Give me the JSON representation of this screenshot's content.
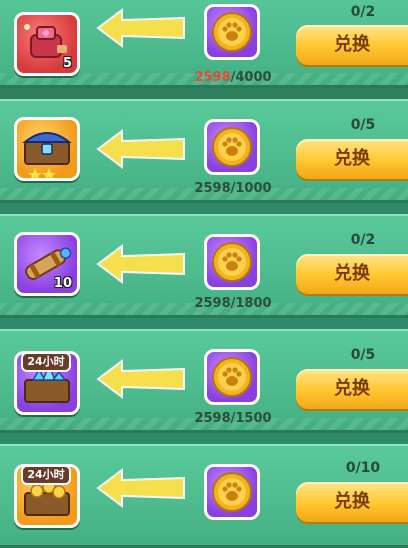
{
  "currency_icon": "paw-coin-icon",
  "colors": {
    "row_bg": "#4dbb8d",
    "button": "#ffc62e",
    "button_text": "#7a3b0a",
    "insufficient": "#e24a3a"
  },
  "items": [
    {
      "reward_icon": "red-gem-box-icon",
      "reward_qty": "5",
      "tag": "",
      "cost_have": "2598",
      "cost_need": "4000",
      "insufficient": true,
      "limit": "0/2",
      "button": "兑换"
    },
    {
      "reward_icon": "treasure-chest-icon",
      "reward_qty": "",
      "tag": "",
      "cost_have": "2598",
      "cost_need": "1000",
      "insufficient": false,
      "limit": "0/5",
      "button": "兑换"
    },
    {
      "reward_icon": "scroll-cannon-icon",
      "reward_qty": "10",
      "tag": "",
      "cost_have": "2598",
      "cost_need": "1800",
      "insufficient": false,
      "limit": "0/2",
      "button": "兑换"
    },
    {
      "reward_icon": "diamond-crate-icon",
      "reward_qty": "",
      "tag": "24小时",
      "cost_have": "2598",
      "cost_need": "1500",
      "insufficient": false,
      "limit": "0/5",
      "button": "兑换"
    },
    {
      "reward_icon": "gold-crate-icon",
      "reward_qty": "",
      "tag": "24小时",
      "cost_have": "",
      "cost_need": "",
      "insufficient": false,
      "limit": "0/10",
      "button": "兑换"
    }
  ]
}
